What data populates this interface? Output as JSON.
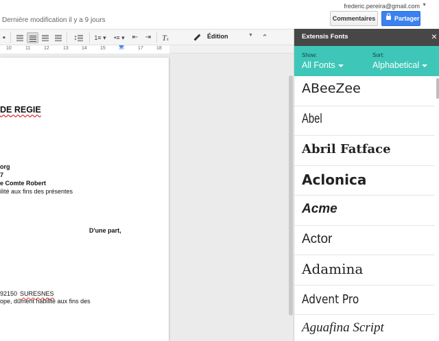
{
  "topbar": {
    "last_modified": "Dernière modification il y a 9 jours",
    "user_email": "frederic.pereira@gmail.com",
    "comments_label": "Commentaires",
    "share_label": "Partager"
  },
  "toolbar": {
    "edition_label": "Édition"
  },
  "ruler": {
    "numbers": [
      "10",
      "11",
      "12",
      "13",
      "14",
      "15",
      "16",
      "17",
      "18"
    ]
  },
  "document": {
    "lines": [
      "DE REGIE",
      "org",
      "7",
      "e Comte Robert",
      "ilité aux fins des présentes",
      "D'une part,",
      "92150",
      "SURESNES",
      "ope, dûment habilité aux fins des"
    ]
  },
  "panel": {
    "title": "Extensis Fonts",
    "show_label": "Show:",
    "show_value": "All Fonts",
    "sort_label": "Sort:",
    "sort_value": "Alphabetical",
    "fonts": [
      "ABeeZee",
      "Abel",
      "Abril Fatface",
      "Aclonica",
      "Acme",
      "Actor",
      "Adamina",
      "Advent Pro",
      "Aguafina Script"
    ]
  },
  "colors": {
    "teal": "#3ec7b8",
    "panel_header": "#474747",
    "share_blue": "#3b82f0"
  }
}
